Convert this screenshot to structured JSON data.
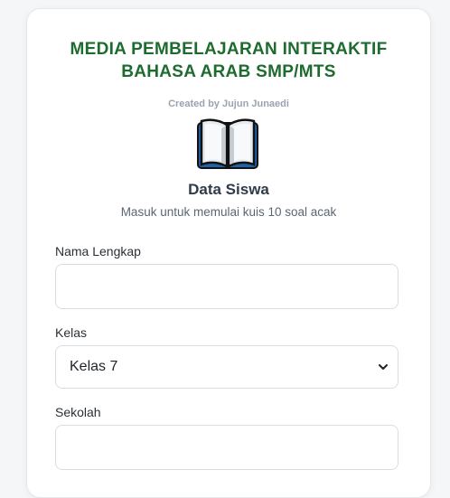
{
  "header": {
    "title_line1": "MEDIA PEMBELAJARAN INTERAKTIF",
    "title_line2": "BAHASA ARAB SMP/MTS",
    "credit": "Created by Jujun Junaedi",
    "icon": "open-book-icon"
  },
  "section": {
    "title": "Data Siswa",
    "description": "Masuk untuk memulai kuis 10 soal acak"
  },
  "form": {
    "name_label": "Nama Lengkap",
    "name_value": "",
    "class_label": "Kelas",
    "class_value": "Kelas 7",
    "school_label": "Sekolah",
    "school_value": ""
  },
  "colors": {
    "title": "#1e6b2f",
    "accent_book": "#1e63a8"
  }
}
